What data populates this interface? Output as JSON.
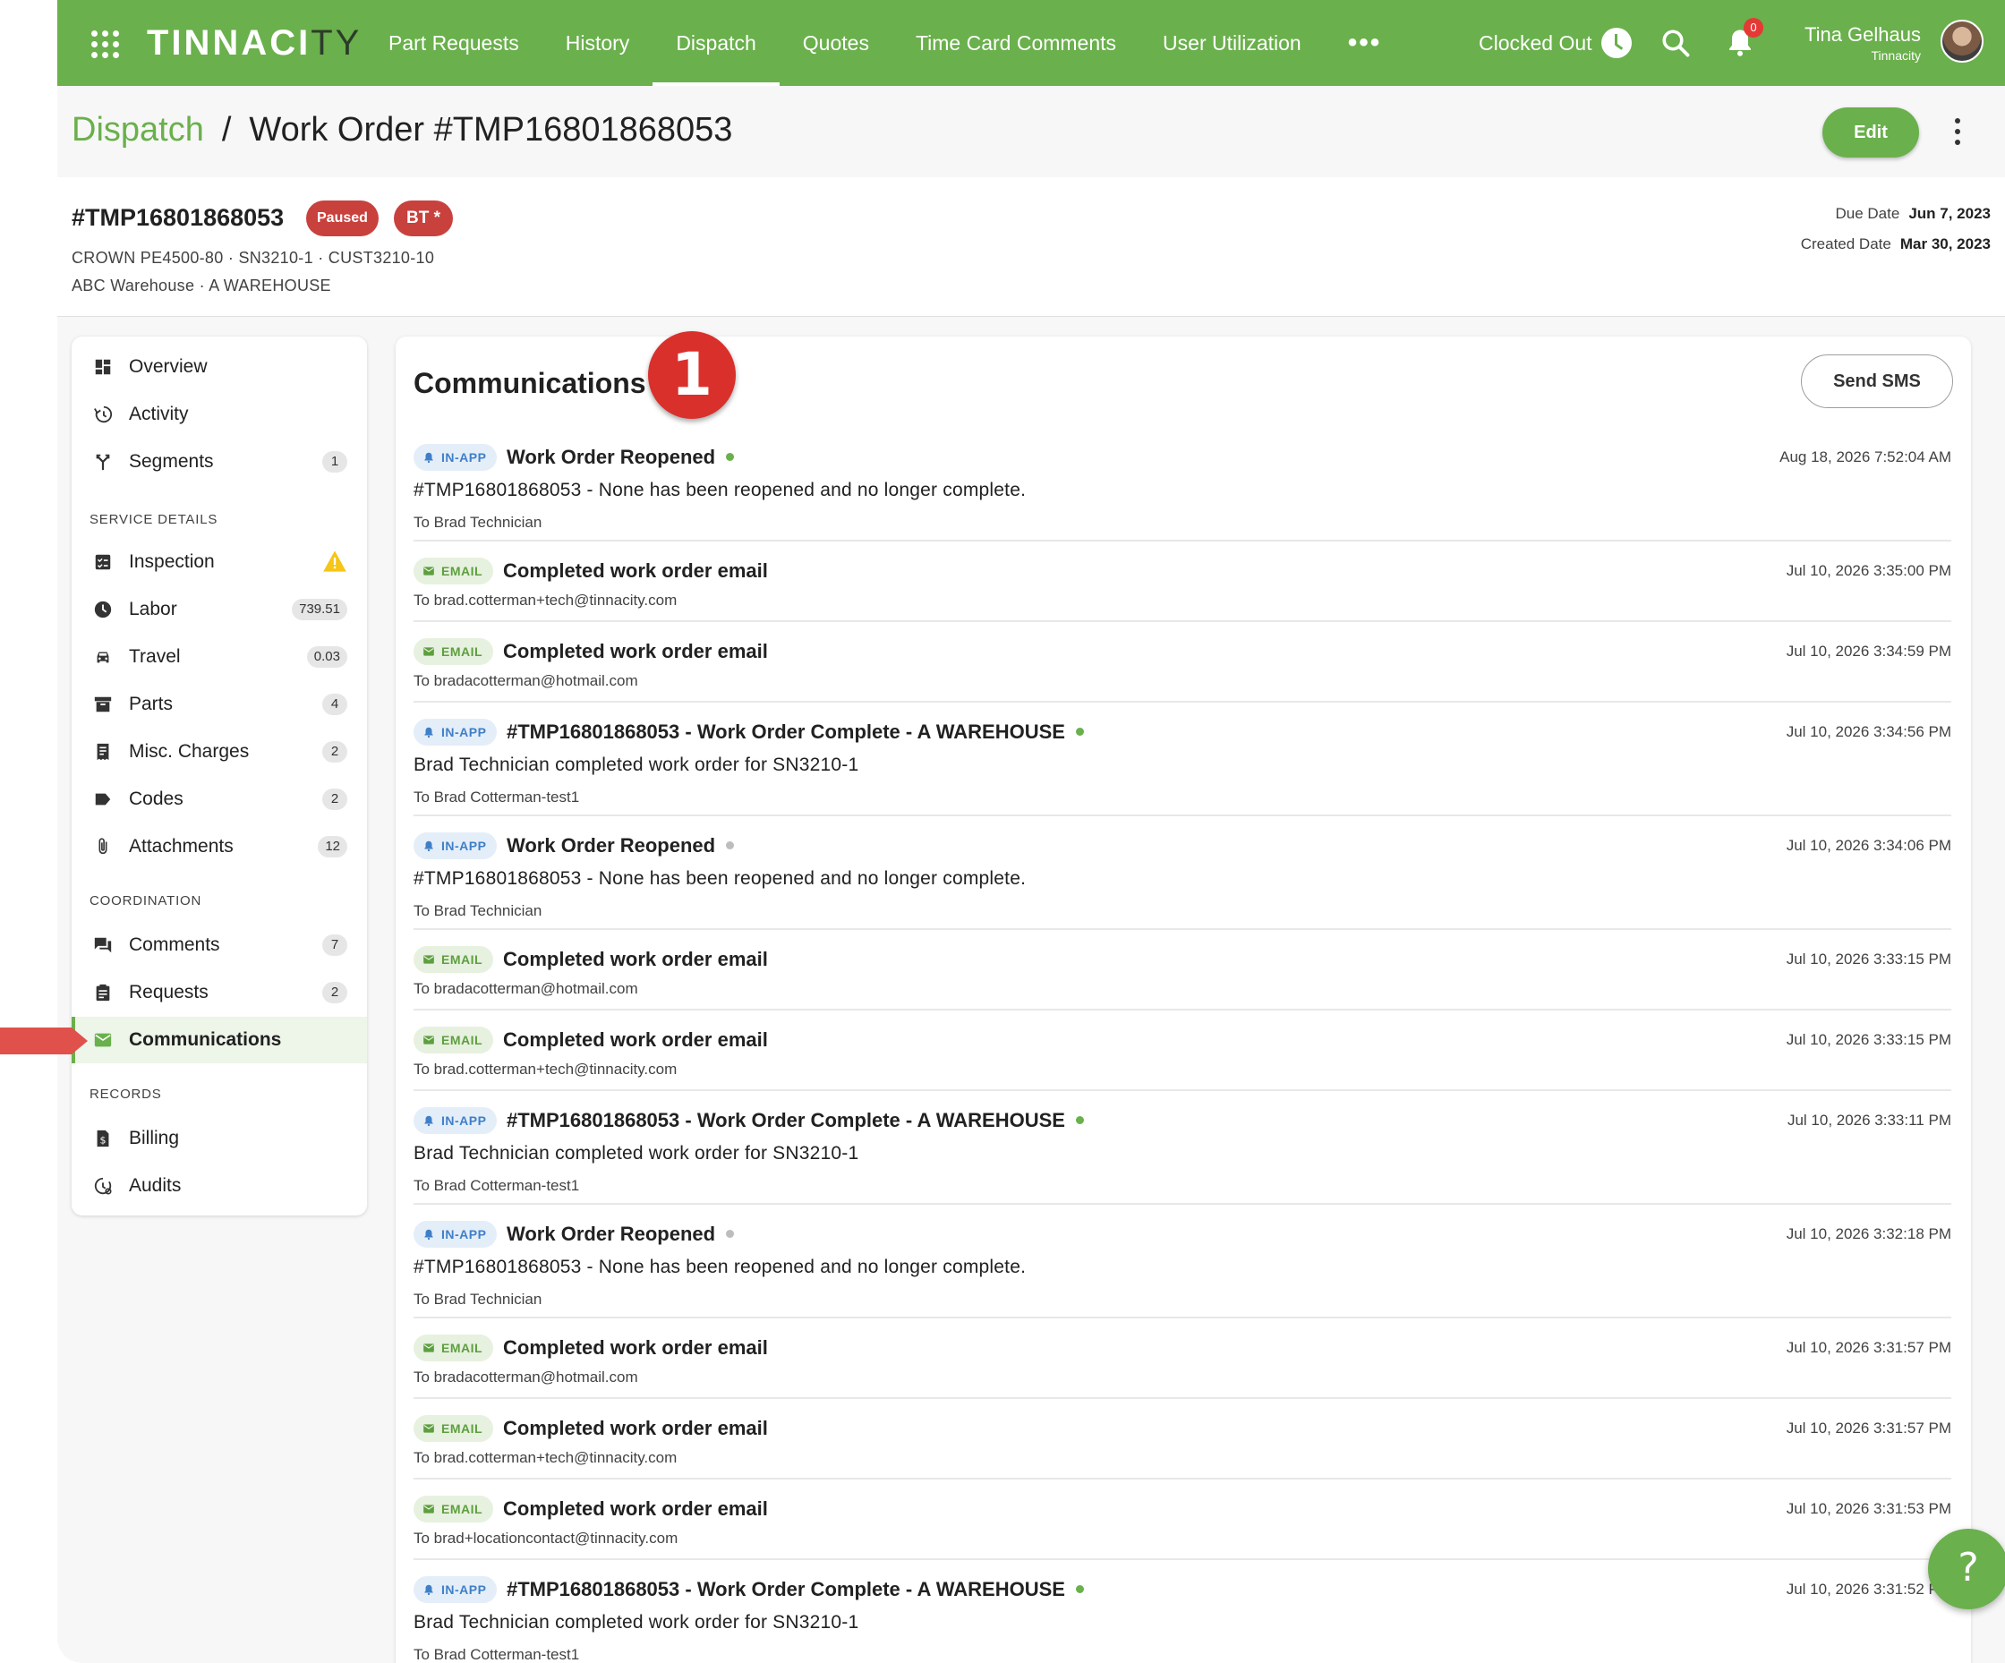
{
  "app": {
    "logo_text_main": "TINNACI",
    "logo_text_tail": "TY"
  },
  "nav": {
    "items": [
      "Part Requests",
      "History",
      "Dispatch",
      "Quotes",
      "Time Card Comments",
      "User Utilization"
    ],
    "active": "Dispatch",
    "more_label": "•••"
  },
  "topbar": {
    "clock_status": "Clocked Out",
    "notification_count": "0",
    "user_name": "Tina Gelhaus",
    "user_org": "Tinnacity"
  },
  "breadcrumb": {
    "parent": "Dispatch",
    "separator": "/",
    "current": "Work Order #TMP16801868053"
  },
  "actions": {
    "edit_label": "Edit"
  },
  "work_order": {
    "number": "#TMP16801868053",
    "status_badge": "Paused",
    "assignee_badge": "BT *",
    "equipment_line": "CROWN PE4500-80 · SN3210-1 · CUST3210-10",
    "location_line": "ABC Warehouse · A WAREHOUSE",
    "due_date_label": "Due Date",
    "due_date": "Jun 7, 2023",
    "created_date_label": "Created Date",
    "created_date": "Mar 30, 2023"
  },
  "sidebar": {
    "top_items": [
      {
        "label": "Overview",
        "icon": "dashboard-icon",
        "count": ""
      },
      {
        "label": "Activity",
        "icon": "history-icon",
        "count": ""
      },
      {
        "label": "Segments",
        "icon": "fork-icon",
        "count": "1"
      }
    ],
    "service_section": "SERVICE DETAILS",
    "service_items": [
      {
        "label": "Inspection",
        "icon": "checklist-icon",
        "warning": true
      },
      {
        "label": "Labor",
        "icon": "clock-icon",
        "count": "739.51"
      },
      {
        "label": "Travel",
        "icon": "car-icon",
        "count": "0.03"
      },
      {
        "label": "Parts",
        "icon": "archive-icon",
        "count": "4"
      },
      {
        "label": "Misc. Charges",
        "icon": "receipt-icon",
        "count": "2"
      },
      {
        "label": "Codes",
        "icon": "label-icon",
        "count": "2"
      },
      {
        "label": "Attachments",
        "icon": "paperclip-icon",
        "count": "12"
      }
    ],
    "coordination_section": "COORDINATION",
    "coordination_items": [
      {
        "label": "Comments",
        "icon": "forum-icon",
        "count": "7"
      },
      {
        "label": "Requests",
        "icon": "clipboard-icon",
        "count": "2"
      },
      {
        "label": "Communications",
        "icon": "mail-icon",
        "count": "",
        "active": true
      }
    ],
    "records_section": "RECORDS",
    "records_items": [
      {
        "label": "Billing",
        "icon": "invoice-icon"
      },
      {
        "label": "Audits",
        "icon": "audit-history-icon"
      }
    ]
  },
  "communications": {
    "title": "Communications",
    "step_badge": "1",
    "send_sms_label": "Send SMS",
    "type_labels": {
      "inapp": "IN-APP",
      "email": "EMAIL"
    },
    "items": [
      {
        "type": "inapp",
        "title": "Work Order Reopened",
        "dot": "green",
        "time": "Aug 18, 2026 7:52:04 AM",
        "body": "#TMP16801868053 - None has been reopened and no longer complete.",
        "to": "To Brad Technician"
      },
      {
        "type": "email",
        "title": "Completed work order email",
        "dot": "",
        "time": "Jul 10, 2026 3:35:00 PM",
        "body": "",
        "to": "To brad.cotterman+tech@tinnacity.com"
      },
      {
        "type": "email",
        "title": "Completed work order email",
        "dot": "",
        "time": "Jul 10, 2026 3:34:59 PM",
        "body": "",
        "to": "To bradacotterman@hotmail.com"
      },
      {
        "type": "inapp",
        "title": "#TMP16801868053 - Work Order Complete - A WAREHOUSE",
        "dot": "green",
        "time": "Jul 10, 2026 3:34:56 PM",
        "body": "Brad Technician completed work order for SN3210-1",
        "to": "To Brad Cotterman-test1"
      },
      {
        "type": "inapp",
        "title": "Work Order Reopened",
        "dot": "grey",
        "time": "Jul 10, 2026 3:34:06 PM",
        "body": "#TMP16801868053 - None has been reopened and no longer complete.",
        "to": "To Brad Technician"
      },
      {
        "type": "email",
        "title": "Completed work order email",
        "dot": "",
        "time": "Jul 10, 2026 3:33:15 PM",
        "body": "",
        "to": "To bradacotterman@hotmail.com"
      },
      {
        "type": "email",
        "title": "Completed work order email",
        "dot": "",
        "time": "Jul 10, 2026 3:33:15 PM",
        "body": "",
        "to": "To brad.cotterman+tech@tinnacity.com"
      },
      {
        "type": "inapp",
        "title": "#TMP16801868053 - Work Order Complete - A WAREHOUSE",
        "dot": "green",
        "time": "Jul 10, 2026 3:33:11 PM",
        "body": "Brad Technician completed work order for SN3210-1",
        "to": "To Brad Cotterman-test1"
      },
      {
        "type": "inapp",
        "title": "Work Order Reopened",
        "dot": "grey",
        "time": "Jul 10, 2026 3:32:18 PM",
        "body": "#TMP16801868053 - None has been reopened and no longer complete.",
        "to": "To Brad Technician"
      },
      {
        "type": "email",
        "title": "Completed work order email",
        "dot": "",
        "time": "Jul 10, 2026 3:31:57 PM",
        "body": "",
        "to": "To bradacotterman@hotmail.com"
      },
      {
        "type": "email",
        "title": "Completed work order email",
        "dot": "",
        "time": "Jul 10, 2026 3:31:57 PM",
        "body": "",
        "to": "To brad.cotterman+tech@tinnacity.com"
      },
      {
        "type": "email",
        "title": "Completed work order email",
        "dot": "",
        "time": "Jul 10, 2026 3:31:53 PM",
        "body": "",
        "to": "To brad+locationcontact@tinnacity.com"
      },
      {
        "type": "inapp",
        "title": "#TMP16801868053 - Work Order Complete - A WAREHOUSE",
        "dot": "green",
        "time": "Jul 10, 2026 3:31:52 PM",
        "body": "Brad Technician completed work order for SN3210-1",
        "to": "To Brad Cotterman-test1"
      }
    ]
  },
  "help": {
    "label": "?"
  },
  "colors": {
    "brand_green": "#6ab04c",
    "status_red": "#c8413d",
    "inapp_blue": "#3f7fc8"
  }
}
